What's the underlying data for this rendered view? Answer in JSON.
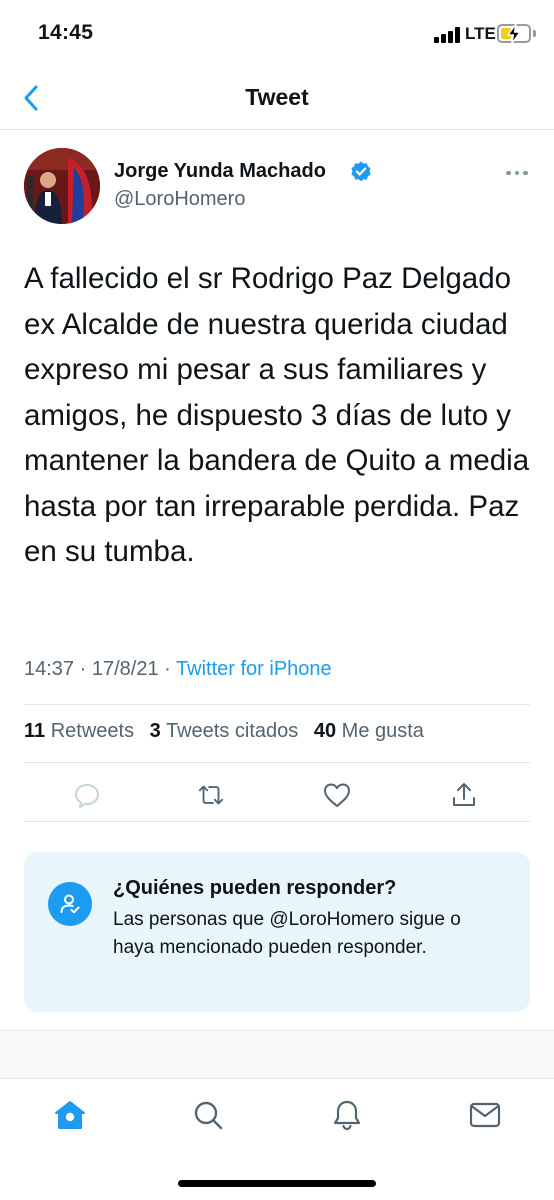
{
  "status_bar": {
    "time": "14:45",
    "network": "LTE",
    "battery_level": 0.4
  },
  "header": {
    "title": "Tweet",
    "back_icon": "chevron-left-icon"
  },
  "tweet": {
    "author_name": "Jorge Yunda Machado",
    "author_handle": "@LoroHomero",
    "verified": true,
    "text": "A fallecido el sr Rodrigo Paz Delgado ex Alcalde de nuestra querida ciudad expreso mi pesar a sus familiares y amigos, he dispuesto 3 días de luto y mantener la bandera de Quito a media hasta por tan irreparable perdida. Paz en su tumba.",
    "time": "14:37",
    "date": "17/8/21",
    "separator": "·",
    "source": "Twitter for iPhone"
  },
  "stats": {
    "retweets_count": "11",
    "retweets_label": "Retweets",
    "quotes_count": "3",
    "quotes_label": "Tweets citados",
    "likes_count": "40",
    "likes_label": "Me gusta"
  },
  "actions": [
    "reply-icon",
    "retweet-icon",
    "like-icon",
    "share-icon"
  ],
  "reply_restriction": {
    "title": "¿Quiénes pueden responder?",
    "body": "Las personas que @LoroHomero sigue o haya mencionado pueden responder."
  },
  "tab_bar": {
    "items": [
      "home-icon",
      "search-icon",
      "notifications-icon",
      "messages-icon"
    ],
    "active": "home-icon"
  },
  "colors": {
    "accent": "#1d9bf0",
    "secondary_text": "#536471",
    "card_background": "#e8f5fd"
  }
}
